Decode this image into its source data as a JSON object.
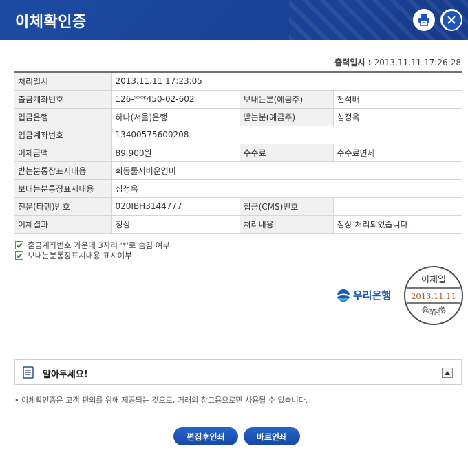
{
  "header": {
    "title": "이체확인증",
    "print_icon": "printer-icon",
    "close_icon": "close-icon"
  },
  "printed": {
    "label": "출력일시 : ",
    "value": "2013.11.11 17:26:28"
  },
  "table": {
    "rows": [
      [
        {
          "l": "처리일시",
          "v": "2013.11.11 17:23:05",
          "span": true
        }
      ],
      [
        {
          "l": "출금계좌번호",
          "v": "126-***450-02-602"
        },
        {
          "l": "보내는분(예금주)",
          "v": "천석배"
        }
      ],
      [
        {
          "l": "입금은행",
          "v": "하나(서울)은행"
        },
        {
          "l": "받는분(예금주)",
          "v": "심정옥"
        }
      ],
      [
        {
          "l": "입금계좌번호",
          "v": "13400575600208",
          "span": true
        }
      ],
      [
        {
          "l": "이체금액",
          "v": "89,900원"
        },
        {
          "l": "수수료",
          "v": "수수료면제"
        }
      ],
      [
        {
          "l": "받는분통장표시내용",
          "v": "회동룰서버운영비",
          "span": true
        }
      ],
      [
        {
          "l": "보내는분통장표시내용",
          "v": "심정옥",
          "span": true
        }
      ],
      [
        {
          "l": "전문(타행)번호",
          "v": "020IBH3144777"
        },
        {
          "l": "집금(CMS)번호",
          "v": ""
        }
      ],
      [
        {
          "l": "이체결과",
          "v": "정상"
        },
        {
          "l": "처리내용",
          "v": "정상 처리되었습니다."
        }
      ]
    ]
  },
  "checks": {
    "mask": {
      "label": "출금계좌번호 가운데 3자리 '*'로 숨김 여부",
      "checked": true
    },
    "show_memo": {
      "label": "보내는분통장표시내용 표시여부",
      "checked": true
    }
  },
  "bank": {
    "name": "우리은행",
    "color": "#1a5bb4"
  },
  "stamp": {
    "top": "이체일",
    "date": "2013.11.11",
    "bottom": "우리은행",
    "date_color": "#a05a1e"
  },
  "notice": {
    "title": "알아두세요!",
    "text": "이체확인증은 고객 편의를 위해 제공되는 것으로, 거래의 참고용으로만 사용될 수 있습니다."
  },
  "buttons": {
    "edit_print": "편집후인쇄",
    "direct_print": "바로인쇄"
  }
}
